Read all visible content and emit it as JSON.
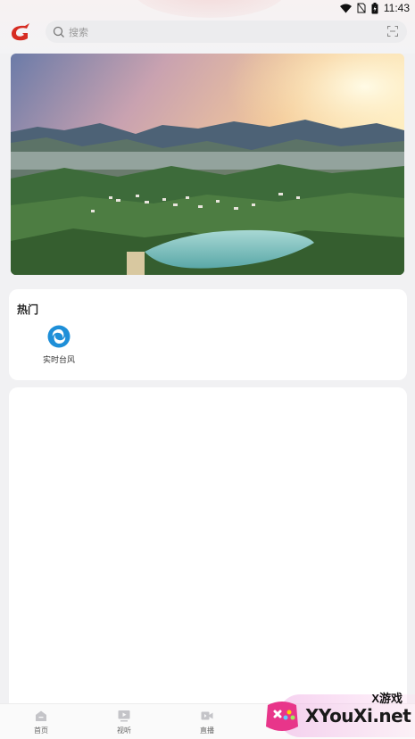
{
  "status_bar": {
    "time": "11:43"
  },
  "search": {
    "placeholder": "搜索"
  },
  "banner": {
    "description_icon": "landscape-photo"
  },
  "hot": {
    "title": "热门",
    "items": [
      {
        "label": "实时台风",
        "icon": "typhoon-icon"
      }
    ]
  },
  "bottom_nav": {
    "items": [
      {
        "label": "首页",
        "icon": "home-icon"
      },
      {
        "label": "视听",
        "icon": "tv-icon"
      },
      {
        "label": "直播",
        "icon": "video-icon"
      }
    ]
  },
  "watermark": {
    "small_text": "X游戏",
    "big_text": "XYouXi.net"
  },
  "colors": {
    "accent": "#1e8fd8",
    "logo_red": "#d62c22"
  }
}
